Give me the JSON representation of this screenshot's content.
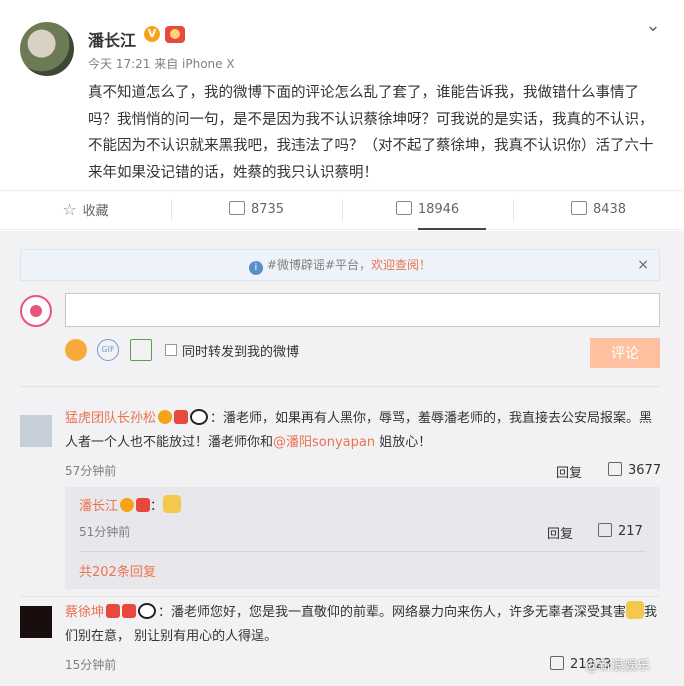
{
  "post": {
    "author": "潘长江",
    "v_badge": "V",
    "meta": "今天 17:21 来自 iPhone X",
    "text": "真不知道怎么了，我的微博下面的评论怎么乱了套了，谁能告诉我，我做错什么事情了吗？我悄悄的问一句，是不是因为我不认识蔡徐坤呀？可我说的是实话，我真的不认识，不能因为不认识就来黑我吧，我违法了吗？（对不起了蔡徐坤，我真不认识你）活了六十来年如果没记错的话，姓蔡的我只认识蔡明！"
  },
  "actions": {
    "favorite": "收藏",
    "repost": "8735",
    "comments": "18946",
    "likes": "8438"
  },
  "notice": {
    "prefix": "#微博辟谣#平台，",
    "link": "欢迎查阅！",
    "close": "×"
  },
  "composer": {
    "input_value": "",
    "gif_label": "GIF",
    "repost_label": "同时转发到我的微博",
    "submit": "评论"
  },
  "comments": [
    {
      "name": "猛虎团队长孙松",
      "text_before": "：潘老师，如果再有人黑你，辱骂，羞辱潘老师的，我直接去公安局报案。黑人者一个人也不能放过！潘老师你和",
      "mention": "@潘阳sonyapan",
      "text_after": " 姐放心！",
      "time": "57分钟前",
      "reply": "回复",
      "likes": "3677",
      "sub_reply": {
        "name": "潘长江",
        "time": "51分钟前",
        "reply": "回复",
        "likes": "217",
        "all_replies": "共202条回复"
      }
    },
    {
      "name": "蔡徐坤",
      "text_before": "：潘老师您好，您是我一直敬仰的前辈。网络暴力向来伤人，许多无辜者深受其害",
      "text_after": "我们别在意， 别让别有用心的人得逞。",
      "time": "15分钟前",
      "likes": "21923"
    }
  ],
  "watermark": "@新浪娱乐"
}
